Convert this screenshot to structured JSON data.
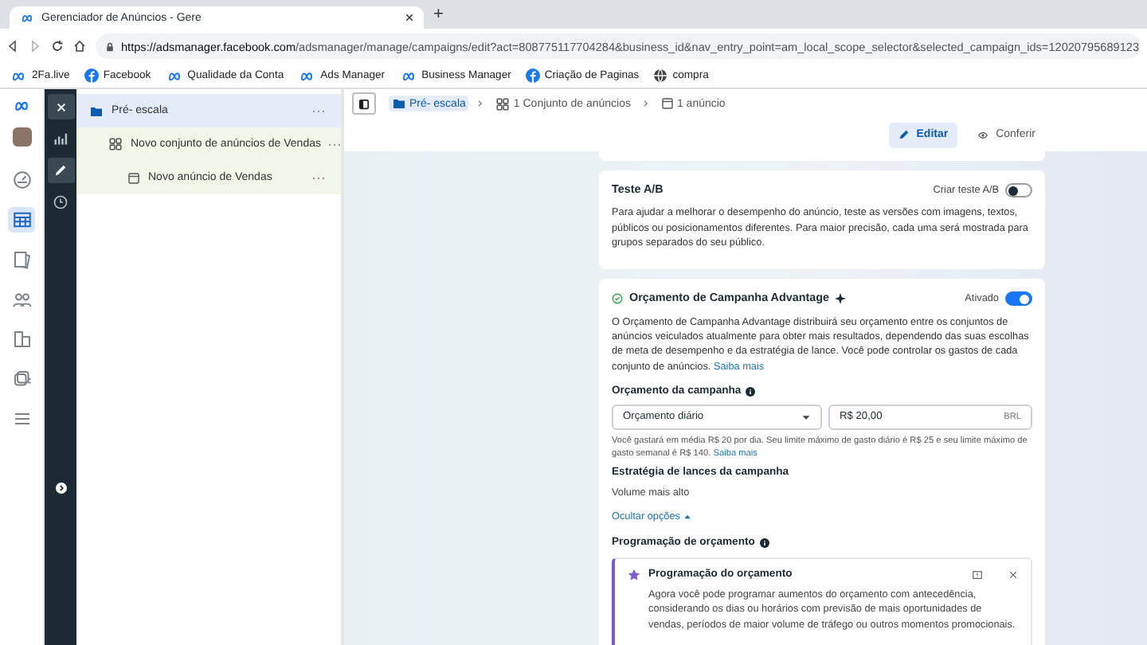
{
  "browser": {
    "tab_title": "Gerenciador de Anúncios - Gere",
    "new_tab": "+",
    "url_host": "https://adsmanager.facebook.com",
    "url_path": "/adsmanager/manage/campaigns/edit?act=808775117704284&business_id&nav_entry_point=am_local_scope_selector&selected_campaign_ids=12020795689123",
    "bookmarks": [
      {
        "kind": "meta",
        "label": "2Fa.live"
      },
      {
        "kind": "facebook",
        "label": "Facebook"
      },
      {
        "kind": "meta",
        "label": "Qualidade da Conta"
      },
      {
        "kind": "meta",
        "label": "Ads Manager"
      },
      {
        "kind": "meta",
        "label": "Business Manager"
      },
      {
        "kind": "facebook",
        "label": "Criação de Paginas"
      },
      {
        "kind": "globe",
        "label": "compra"
      }
    ]
  },
  "nav_rail": [
    {
      "kind": "gauge",
      "selected": false
    },
    {
      "kind": "table",
      "selected": true
    },
    {
      "kind": "pages",
      "selected": false
    },
    {
      "kind": "people",
      "selected": false
    },
    {
      "kind": "docs",
      "selected": false
    },
    {
      "kind": "stack",
      "selected": false
    },
    {
      "kind": "menu",
      "selected": false
    }
  ],
  "tool_rail": [
    {
      "kind": "chart",
      "selected": false
    },
    {
      "kind": "pencil",
      "selected": true
    },
    {
      "kind": "clock",
      "selected": false
    }
  ],
  "tree": [
    {
      "kind": "campaign",
      "label": "Pré- escala",
      "selected": true,
      "children": [
        {
          "kind": "adset",
          "label": "Novo conjunto de anúncios de Vendas",
          "selected": false,
          "children": [
            {
              "kind": "ad",
              "label": "Novo anúncio de Vendas",
              "selected": false
            }
          ]
        }
      ]
    }
  ],
  "breadcrumb": [
    {
      "kind": "campaign",
      "label": "Pré- escala",
      "selected": true
    },
    {
      "kind": "adset",
      "label": "1 Conjunto de anúncios",
      "selected": false
    },
    {
      "kind": "ad",
      "label": "1 anúncio",
      "selected": false
    }
  ],
  "actions": [
    {
      "kind": "edit",
      "label": "Editar",
      "selected": true
    },
    {
      "kind": "view",
      "label": "Conferir",
      "selected": false
    }
  ],
  "ab_test": {
    "title": "Teste A/B",
    "toggle_label": "Criar teste A/B",
    "on": false,
    "description": "Para ajudar a melhorar o desempenho do anúncio, teste as versões com imagens, textos, públicos ou posicionamentos diferentes. Para maior precisão, cada uma será mostrada para grupos separados do seu público."
  },
  "budget": {
    "title": "Orçamento de Campanha Advantage",
    "toggle_label": "Ativado",
    "on": true,
    "description": "O Orçamento de Campanha Advantage distribuirá seu orçamento entre os conjuntos de anúncios veiculados atualmente para obter mais resultados, dependendo das suas escolhas de meta de desempenho e da estratégia de lance. Você pode controlar os gastos de cada conjunto de anúncios.",
    "link": "Saiba mais",
    "budget_label": "Orçamento da campanha",
    "budget_type": "Orçamento diário",
    "amount": "R$ 20,00",
    "currency": "BRL",
    "hint": "Você gastará em média R$ 20 por dia. Seu limite máximo de gasto diário é R$ 25 e seu limite máximo de gasto semanal é R$ 140.",
    "hint_link": "Saiba mais",
    "strategy_label": "Estratégia de lances da campanha",
    "strategy_value": "Volume mais alto",
    "toggle_options": "Ocultar opções",
    "schedule_label": "Programação de orçamento",
    "notice": {
      "title": "Programação do orçamento",
      "body": "Agora você pode programar aumentos do orçamento com antecedência, considerando os dias ou horários com previsão de mais oportunidades de vendas, períodos de maior volume de tráfego ou outros momentos promocionais."
    }
  }
}
